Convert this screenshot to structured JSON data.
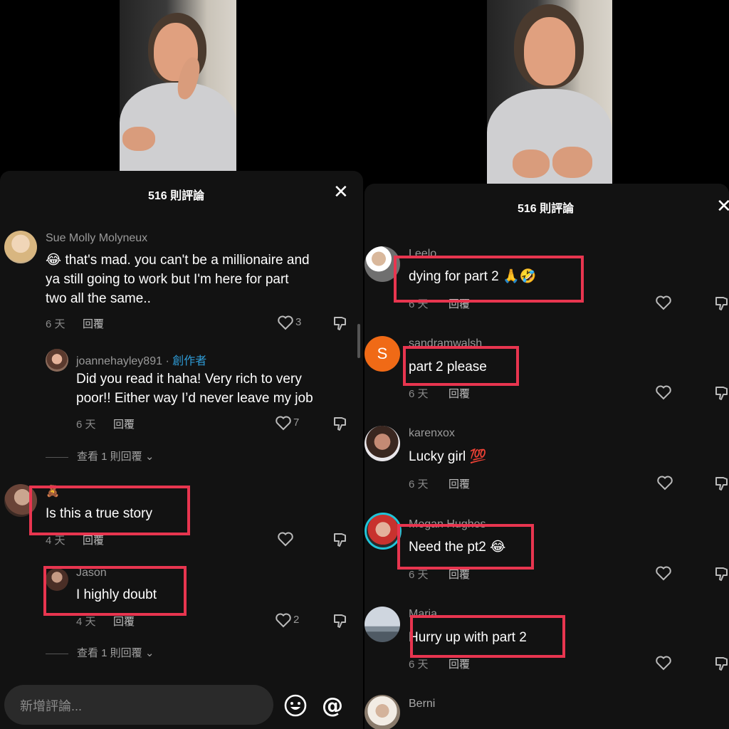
{
  "left": {
    "sheet_title": "516 則評論",
    "comments": [
      {
        "user": "Sue Molly Molyneux",
        "text_lines": [
          "😂 that's mad. you can't be a millionaire and",
          "ya still going to work but I'm here for part",
          "two all the same.."
        ],
        "time": "6 天",
        "reply": "回覆",
        "likes": "3"
      },
      {
        "user": "joannehayley891",
        "sep": " · ",
        "badge": "創作者",
        "text_lines": [
          "Did you read it haha! Very rich to very",
          "poor!! Either way I’d never leave my job"
        ],
        "time": "6 天",
        "reply": "回覆",
        "likes": "7"
      },
      {
        "view_replies": "查看 1 則回覆"
      },
      {
        "user": "🧸",
        "text_lines": [
          "Is this a true story"
        ],
        "time": "4 天",
        "reply": "回覆"
      },
      {
        "user": "Jason",
        "text_lines": [
          "I highly doubt"
        ],
        "time": "4 天",
        "reply": "回覆",
        "likes": "2"
      },
      {
        "view_replies": "查看 1 則回覆"
      }
    ],
    "input_placeholder": "新增評論...",
    "icons": [
      "close-icon",
      "heart-icon",
      "dislike-icon",
      "emoji-icon",
      "mention-icon",
      "chevron-down-icon"
    ]
  },
  "right": {
    "sheet_title": "516 則評論",
    "comments": [
      {
        "user": "Leelo",
        "text": "dying for part 2 🙏🤣",
        "time": "6 天",
        "reply": "回覆"
      },
      {
        "user": "sandramwalsh",
        "avatar_letter": "S",
        "text": "part 2 please",
        "time": "6 天",
        "reply": "回覆"
      },
      {
        "user": "karenxox",
        "text": "Lucky girl 💯",
        "time": "6 天",
        "reply": "回覆"
      },
      {
        "user": "Megan Hughes",
        "text": "Need the pt2 😂",
        "time": "6 天",
        "reply": "回覆"
      },
      {
        "user": "Maria",
        "text": "Hurry up with part 2",
        "time": "6 天",
        "reply": "回覆"
      },
      {
        "user": "Berni"
      }
    ]
  },
  "colors": {
    "highlight": "#e8354f",
    "creator": "#2e9bd6",
    "sheet": "#121212",
    "avatar_s": "#f06a16"
  }
}
